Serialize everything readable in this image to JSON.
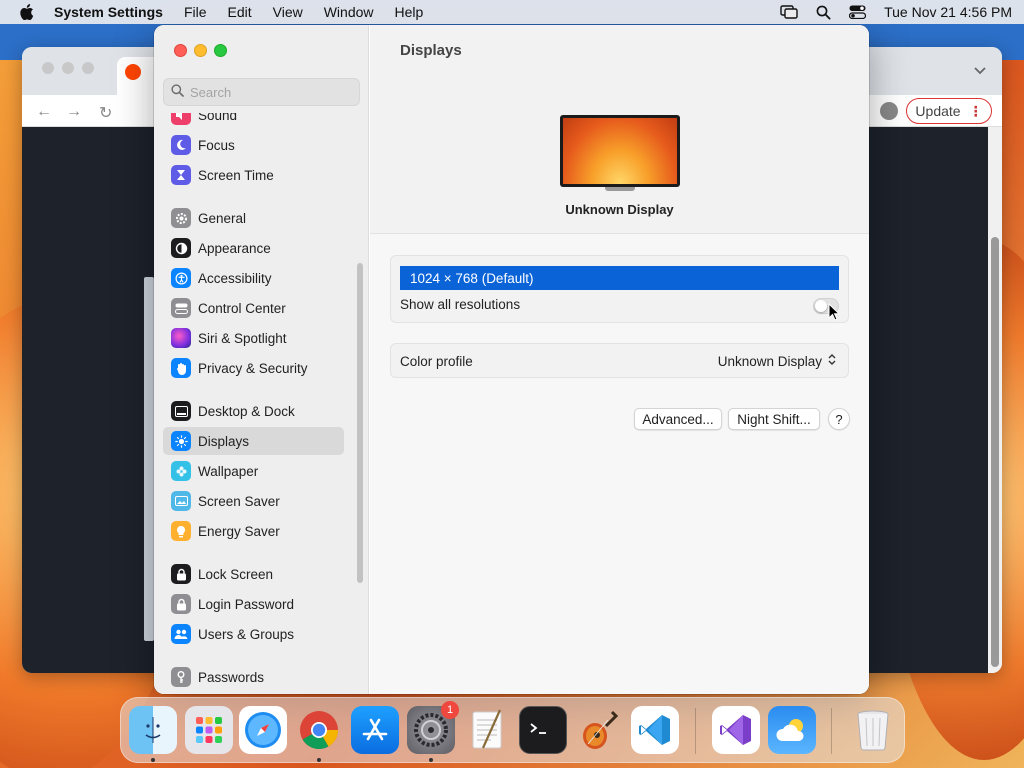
{
  "menubar": {
    "app_name": "System Settings",
    "menus": [
      "File",
      "Edit",
      "View",
      "Window",
      "Help"
    ],
    "clock": "Tue Nov 21  4:56 PM"
  },
  "browser": {
    "update_label": "Update",
    "update_more": "⋮"
  },
  "settings": {
    "search_placeholder": "Search",
    "sidebar": {
      "items": [
        {
          "label": "Sound",
          "icon": "speaker-icon",
          "color": "#ee3e6a"
        },
        {
          "label": "Focus",
          "icon": "moon-icon",
          "color": "#5e5ce6"
        },
        {
          "label": "Screen Time",
          "icon": "hourglass-icon",
          "color": "#5e5ce6"
        },
        {
          "label": "General",
          "icon": "gear-icon",
          "color": "#8e8e93"
        },
        {
          "label": "Appearance",
          "icon": "appearance-icon",
          "color": "#1c1c1e"
        },
        {
          "label": "Accessibility",
          "icon": "accessibility-icon",
          "color": "#0a84ff"
        },
        {
          "label": "Control Center",
          "icon": "control-center-icon",
          "color": "#8e8e93"
        },
        {
          "label": "Siri & Spotlight",
          "icon": "siri-icon",
          "color": "#bf5af2"
        },
        {
          "label": "Privacy & Security",
          "icon": "hand-icon",
          "color": "#0a84ff"
        },
        {
          "label": "Desktop & Dock",
          "icon": "dock-icon",
          "color": "#1c1c1e"
        },
        {
          "label": "Displays",
          "icon": "sun-icon",
          "color": "#0a84ff"
        },
        {
          "label": "Wallpaper",
          "icon": "flower-icon",
          "color": "#34c1e8"
        },
        {
          "label": "Screen Saver",
          "icon": "screen-saver-icon",
          "color": "#4fb8e8"
        },
        {
          "label": "Energy Saver",
          "icon": "bulb-icon",
          "color": "#ffb02e"
        },
        {
          "label": "Lock Screen",
          "icon": "lock-icon",
          "color": "#1c1c1e"
        },
        {
          "label": "Login Password",
          "icon": "lock-icon",
          "color": "#8e8e93"
        },
        {
          "label": "Users & Groups",
          "icon": "users-icon",
          "color": "#0a84ff"
        },
        {
          "label": "Passwords",
          "icon": "key-icon",
          "color": "#8e8e93"
        }
      ],
      "selected": "Displays"
    },
    "main": {
      "title": "Displays",
      "display_name": "Unknown Display",
      "resolution_selected": "1024 × 768 (Default)",
      "show_all_label": "Show all resolutions",
      "show_all_on": false,
      "color_profile_label": "Color profile",
      "color_profile_value": "Unknown Display",
      "advanced_label": "Advanced...",
      "night_shift_label": "Night Shift...",
      "help_label": "?"
    }
  },
  "dock": {
    "apps": [
      {
        "name": "Finder",
        "icon": "finder-icon"
      },
      {
        "name": "Launchpad",
        "icon": "launchpad-icon"
      },
      {
        "name": "Safari",
        "icon": "safari-icon"
      },
      {
        "name": "Chrome",
        "icon": "chrome-icon"
      },
      {
        "name": "App Store",
        "icon": "app-store-icon"
      },
      {
        "name": "System Settings",
        "icon": "system-settings-icon",
        "badge": "1"
      },
      {
        "name": "TextEdit",
        "icon": "textedit-icon"
      },
      {
        "name": "Terminal",
        "icon": "terminal-icon"
      },
      {
        "name": "GarageBand",
        "icon": "guitar-icon"
      },
      {
        "name": "VS Code",
        "icon": "vscode-icon"
      },
      {
        "name": "Visual Studio",
        "icon": "visual-studio-icon"
      },
      {
        "name": "Weather",
        "icon": "weather-icon"
      },
      {
        "name": "Trash",
        "icon": "trash-icon"
      }
    ]
  }
}
